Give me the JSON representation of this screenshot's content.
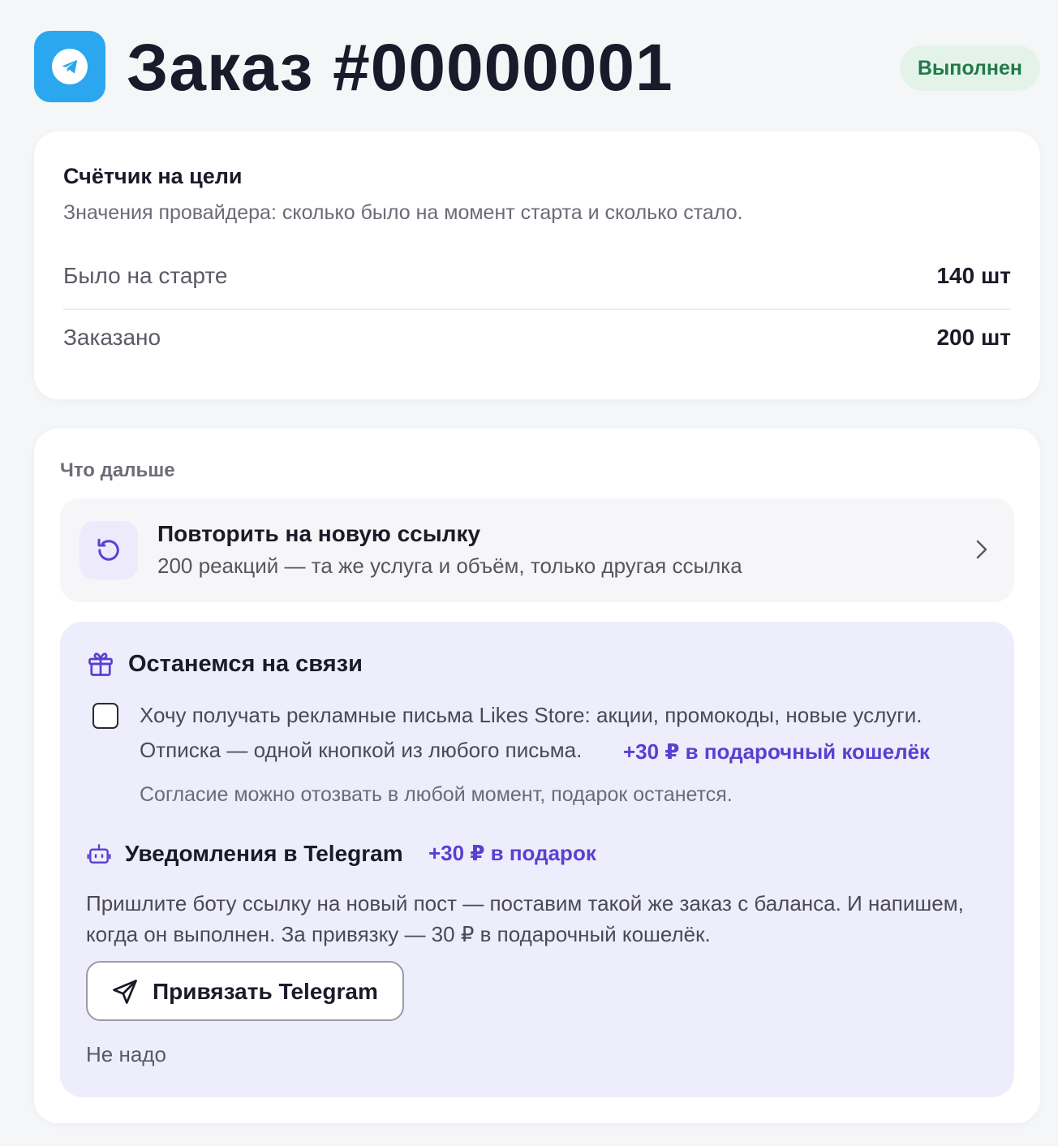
{
  "header": {
    "title": "Заказ #00000001",
    "status": "Выполнен",
    "icon": "telegram-icon"
  },
  "counter": {
    "title": "Счётчик на цели",
    "subtitle": "Значения провайдера: сколько было на момент старта и сколько стало.",
    "rows": [
      {
        "label": "Было на старте",
        "value": "140 шт"
      },
      {
        "label": "Заказано",
        "value": "200 шт"
      }
    ]
  },
  "next": {
    "title": "Что дальше",
    "repeat": {
      "title": "Повторить на новую ссылку",
      "description": "200 реакций — та же услуга и объём, только другая ссылка",
      "icon": "refresh-icon"
    },
    "stay": {
      "title": "Останемся на связи",
      "icon": "gift-icon",
      "consent_line1": "Хочу получать рекламные письма Likes Store: акции, промокоды, новые услуги.",
      "consent_line2": "Отписка — одной кнопкой из любого письма.",
      "email_bonus": "+30 ₽ в подарочный кошелёк",
      "consent_checked": false,
      "consent_note": "Согласие можно отозвать в любой момент, подарок останется.",
      "notify_title": "Уведомления в Telegram",
      "notify_bonus": "+30 ₽ в подарок",
      "notify_icon": "bot-icon",
      "notify_description": "Пришлите боту ссылку на новый пост — поставим такой же заказ с баланса. И напишем, когда он выполнен. За привязку — 30 ₽ в подарочный кошелёк.",
      "link_button": "Привязать Telegram",
      "dismiss": "Не надо"
    }
  },
  "colors": {
    "accent": "#5a3fd1",
    "telegram": "#2aa7ee",
    "status_bg": "#e4f3ea",
    "status_text": "#227a4a",
    "stay_bg": "#eeedfb"
  }
}
